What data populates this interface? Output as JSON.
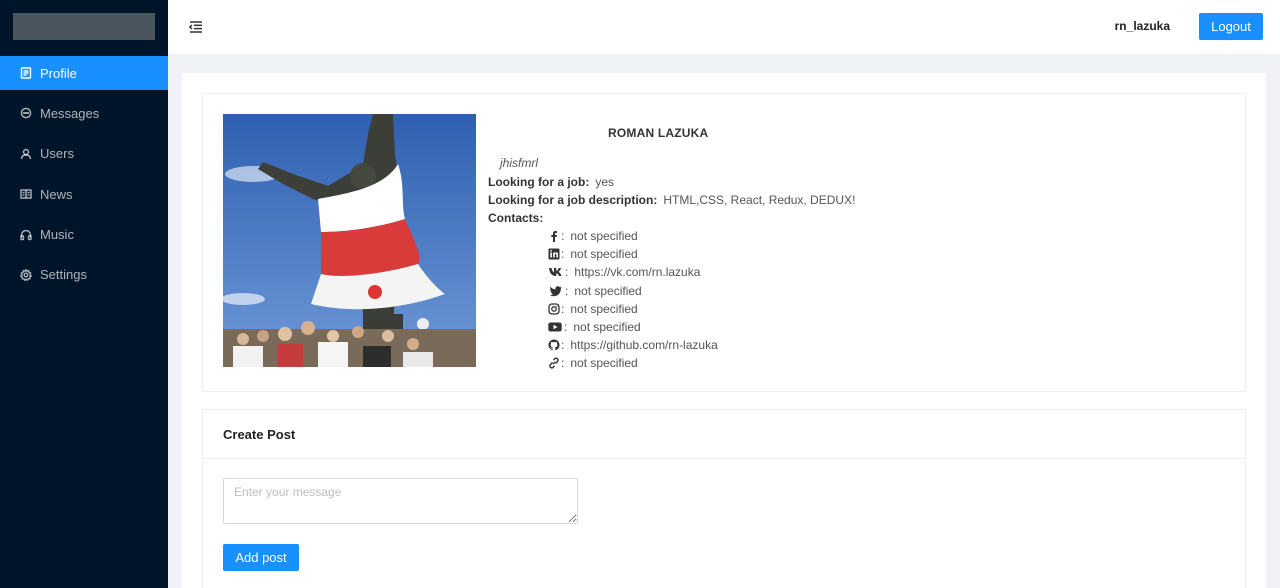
{
  "sidebar": {
    "items": [
      {
        "label": "Profile",
        "icon": "profile-icon",
        "active": true
      },
      {
        "label": "Messages",
        "icon": "messages-icon"
      },
      {
        "label": "Users",
        "icon": "user-icon"
      },
      {
        "label": "News",
        "icon": "news-icon"
      },
      {
        "label": "Music",
        "icon": "headphones-icon"
      },
      {
        "label": "Settings",
        "icon": "gear-icon"
      }
    ]
  },
  "header": {
    "username": "rn_lazuka",
    "logout_label": "Logout"
  },
  "profile": {
    "full_name": "ROMAN LAZUKA",
    "status": "jhisfmrl",
    "job_label": "Looking for a job:",
    "job_value": "yes",
    "job_desc_label": "Looking for a job description:",
    "job_desc_value": "HTML,CSS, React, Redux, DEDUX!",
    "contacts_label": "Contacts:",
    "contacts": [
      {
        "icon": "facebook-icon",
        "value": "not specified"
      },
      {
        "icon": "linkedin-icon",
        "value": "not specified"
      },
      {
        "icon": "vk-icon",
        "value": "https://vk.com/rn.lazuka"
      },
      {
        "icon": "twitter-icon",
        "value": "not specified"
      },
      {
        "icon": "instagram-icon",
        "value": "not specified"
      },
      {
        "icon": "youtube-icon",
        "value": "not specified"
      },
      {
        "icon": "github-icon",
        "value": "https://github.com/rn-lazuka"
      },
      {
        "icon": "link-icon",
        "value": "not specified"
      }
    ]
  },
  "post": {
    "title": "Create Post",
    "placeholder": "Enter your message",
    "button_label": "Add post"
  },
  "colors": {
    "accent": "#1890ff",
    "sider": "#001529"
  }
}
